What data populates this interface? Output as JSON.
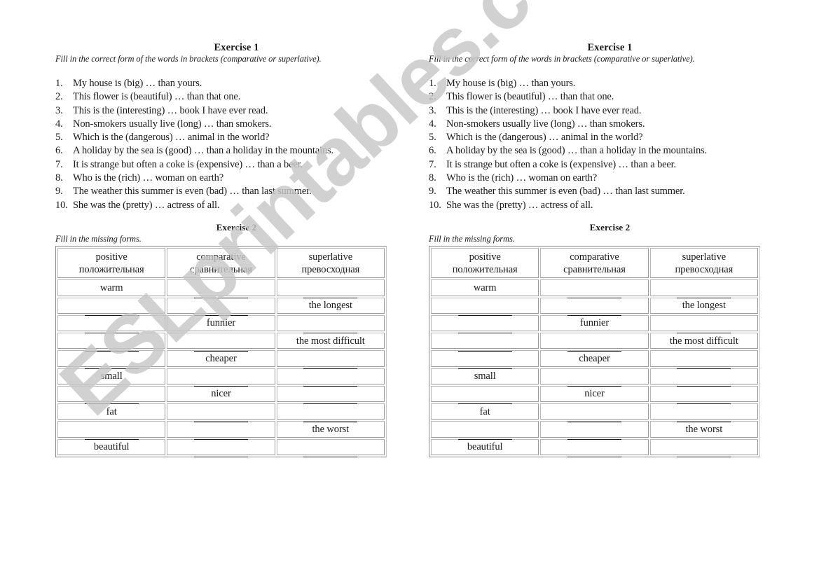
{
  "watermark": "ESLprintables.com",
  "copies": [
    {
      "exercise1": {
        "title": "Exercise 1",
        "instruction": "Fill in the correct form of the words in brackets (comparative or superlative).",
        "sentences": [
          {
            "num": "1.",
            "text": "My house is (big) … than yours."
          },
          {
            "num": "2.",
            "text": "This flower is (beautiful) … than that one."
          },
          {
            "num": "3.",
            "text": "This is the (interesting) … book I have ever read."
          },
          {
            "num": "4.",
            "text": "Non-smokers usually live (long) … than smokers."
          },
          {
            "num": "5.",
            "text": "Which is the (dangerous) … animal in the world?"
          },
          {
            "num": "6.",
            "text": "A holiday by the sea is (good) … than a holiday in the mountains."
          },
          {
            "num": "7.",
            "text": "It is strange but often a coke is (expensive) … than a beer."
          },
          {
            "num": "8.",
            "text": "Who is the (rich) … woman on earth?"
          },
          {
            "num": "9.",
            "text": "The weather this summer is even (bad) … than last summer."
          },
          {
            "num": "10.",
            "text": "She was the (pretty) … actress of all."
          }
        ]
      },
      "exercise2": {
        "title": "Exercise 2",
        "instruction": "Fill in the missing forms.",
        "headers": [
          {
            "en": "positive",
            "ru": "положительная"
          },
          {
            "en": "comparative",
            "ru": "сравнительная"
          },
          {
            "en": "superlative",
            "ru": "превосходная"
          }
        ],
        "rows": [
          [
            "warm",
            "",
            ""
          ],
          [
            "",
            "",
            "the longest"
          ],
          [
            "",
            "funnier",
            ""
          ],
          [
            "",
            "",
            "the most difficult"
          ],
          [
            "",
            "cheaper",
            ""
          ],
          [
            "small",
            "",
            ""
          ],
          [
            "",
            "nicer",
            ""
          ],
          [
            "fat",
            "",
            ""
          ],
          [
            "",
            "",
            "the worst"
          ],
          [
            "beautiful",
            "",
            ""
          ]
        ]
      }
    },
    {
      "exercise1": {
        "title": "Exercise 1",
        "instruction": "Fill in the correct form of the words in brackets (comparative or superlative).",
        "sentences": [
          {
            "num": "1.",
            "text": "My house is (big) … than yours."
          },
          {
            "num": "2.",
            "text": "This flower is (beautiful) … than that one."
          },
          {
            "num": "3.",
            "text": "This is the (interesting) … book I have ever read."
          },
          {
            "num": "4.",
            "text": "Non-smokers usually live (long) … than smokers."
          },
          {
            "num": "5.",
            "text": "Which is the (dangerous) … animal in the world?"
          },
          {
            "num": "6.",
            "text": "A holiday by the sea is (good) … than a holiday in the mountains."
          },
          {
            "num": "7.",
            "text": "It is strange but often a coke is (expensive) … than a beer."
          },
          {
            "num": "8.",
            "text": "Who is the (rich) … woman on earth?"
          },
          {
            "num": "9.",
            "text": "The weather this summer is even (bad) … than last summer."
          },
          {
            "num": "10.",
            "text": "She was the (pretty) … actress of all."
          }
        ]
      },
      "exercise2": {
        "title": "Exercise 2",
        "instruction": "Fill in the missing forms.",
        "headers": [
          {
            "en": "positive",
            "ru": "положительная"
          },
          {
            "en": "comparative",
            "ru": "сравнительная"
          },
          {
            "en": "superlative",
            "ru": "превосходная"
          }
        ],
        "rows": [
          [
            "warm",
            "",
            ""
          ],
          [
            "",
            "",
            "the longest"
          ],
          [
            "",
            "funnier",
            ""
          ],
          [
            "",
            "",
            "the most difficult"
          ],
          [
            "",
            "cheaper",
            ""
          ],
          [
            "small",
            "",
            ""
          ],
          [
            "",
            "nicer",
            ""
          ],
          [
            "fat",
            "",
            ""
          ],
          [
            "",
            "",
            "the worst"
          ],
          [
            "beautiful",
            "",
            ""
          ]
        ]
      }
    }
  ]
}
